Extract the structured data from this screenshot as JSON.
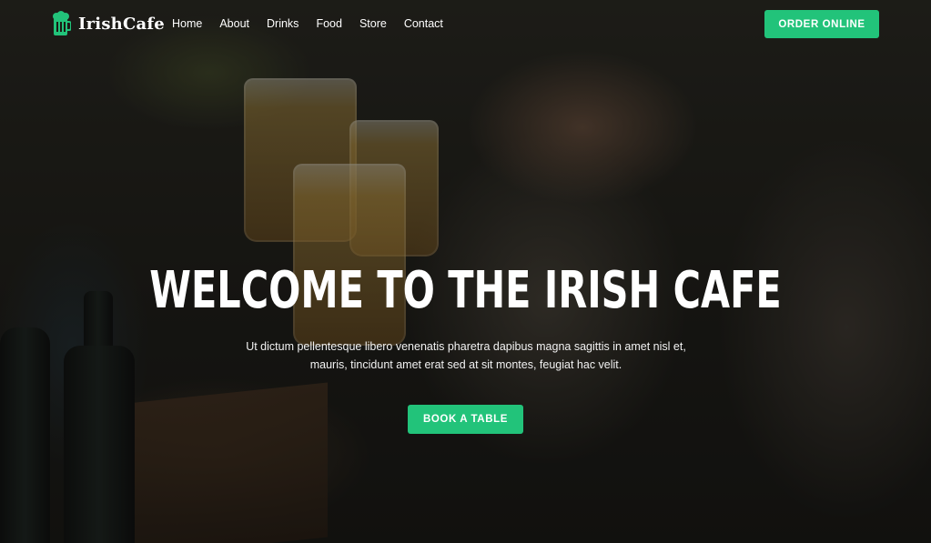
{
  "brand": {
    "name": "IrishCafe",
    "icon": "beer-mug-icon",
    "icon_color": "#22c37a"
  },
  "nav": {
    "items": [
      {
        "label": "Home"
      },
      {
        "label": "About"
      },
      {
        "label": "Drinks"
      },
      {
        "label": "Food"
      },
      {
        "label": "Store"
      },
      {
        "label": "Contact"
      }
    ],
    "cta_label": "ORDER ONLINE"
  },
  "hero": {
    "title": "WELCOME TO THE IRISH CAFE",
    "subtitle_line1": "Ut dictum pellentesque libero venenatis pharetra dapibus magna sagittis in amet nisl et,",
    "subtitle_line2": "mauris, tincidunt amet erat sed at sit montes, feugiat hac velit.",
    "button_label": "BOOK A TABLE"
  },
  "colors": {
    "accent": "#22c37a",
    "text": "#ffffff"
  }
}
